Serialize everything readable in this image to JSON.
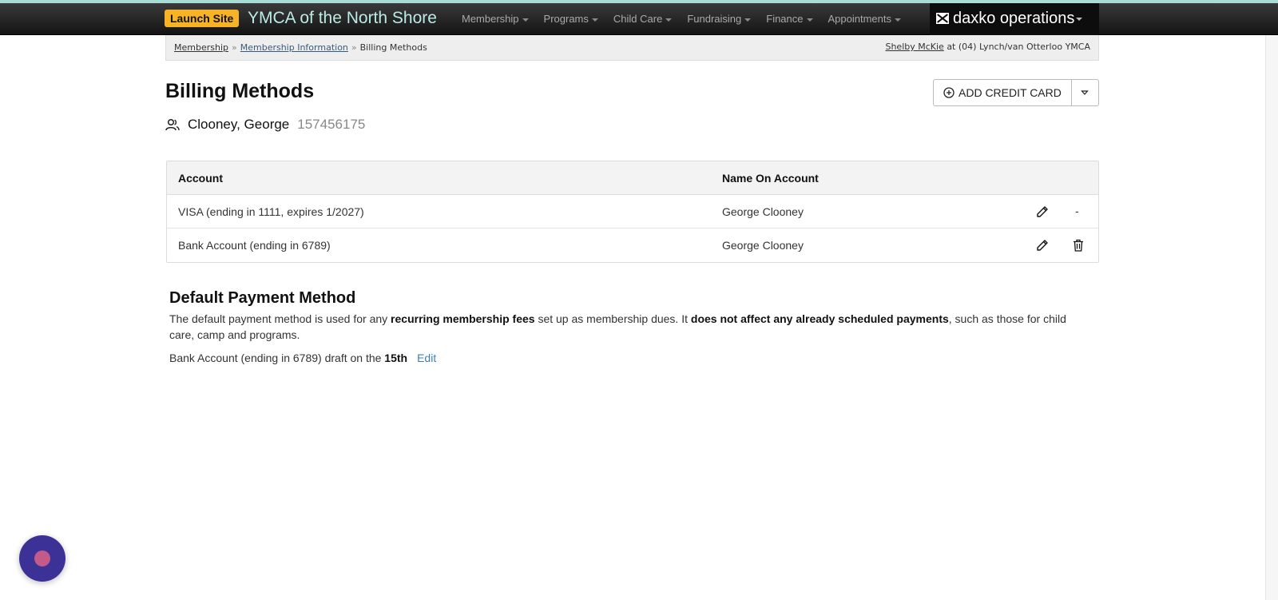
{
  "nav": {
    "launch_label": "Launch Site",
    "brand": "YMCA of the North Shore",
    "menu": [
      {
        "label": "Membership"
      },
      {
        "label": "Programs"
      },
      {
        "label": "Child Care"
      },
      {
        "label": "Fundraising"
      },
      {
        "label": "Finance"
      },
      {
        "label": "Appointments"
      }
    ],
    "product": "daxko operations"
  },
  "breadcrumb": {
    "items": [
      "Membership",
      "Membership Information",
      "Billing Methods"
    ],
    "user_name": "Shelby McKie",
    "user_at": "at (04) Lynch/van Otterloo YMCA"
  },
  "page": {
    "title": "Billing Methods",
    "member_name": "Clooney, George",
    "member_id": "157456175",
    "add_card_label": "ADD CREDIT CARD"
  },
  "table": {
    "headers": [
      "Account",
      "Name On Account"
    ],
    "rows": [
      {
        "account": "VISA (ending in 1111, expires 1/2027)",
        "name": "George Clooney",
        "delete": "-"
      },
      {
        "account": "Bank Account (ending in 6789)",
        "name": "George Clooney",
        "delete": ""
      }
    ]
  },
  "default_payment": {
    "title": "Default Payment Method",
    "text_1": "The default payment method is used for any ",
    "bold_1": "recurring membership fees",
    "text_2": " set up as membership dues. It ",
    "bold_2": "does not affect any already scheduled payments",
    "text_3": ", such as those for child care, camp and programs.",
    "method": "Bank Account (ending in 6789) draft on the ",
    "day": "15th",
    "edit_label": "Edit"
  },
  "colors": {
    "accent": "#a9dcd6",
    "launch": "#f5b325",
    "brand_text": "#b9ece4",
    "link": "#3d7fb8",
    "chat": "#3b3196"
  }
}
